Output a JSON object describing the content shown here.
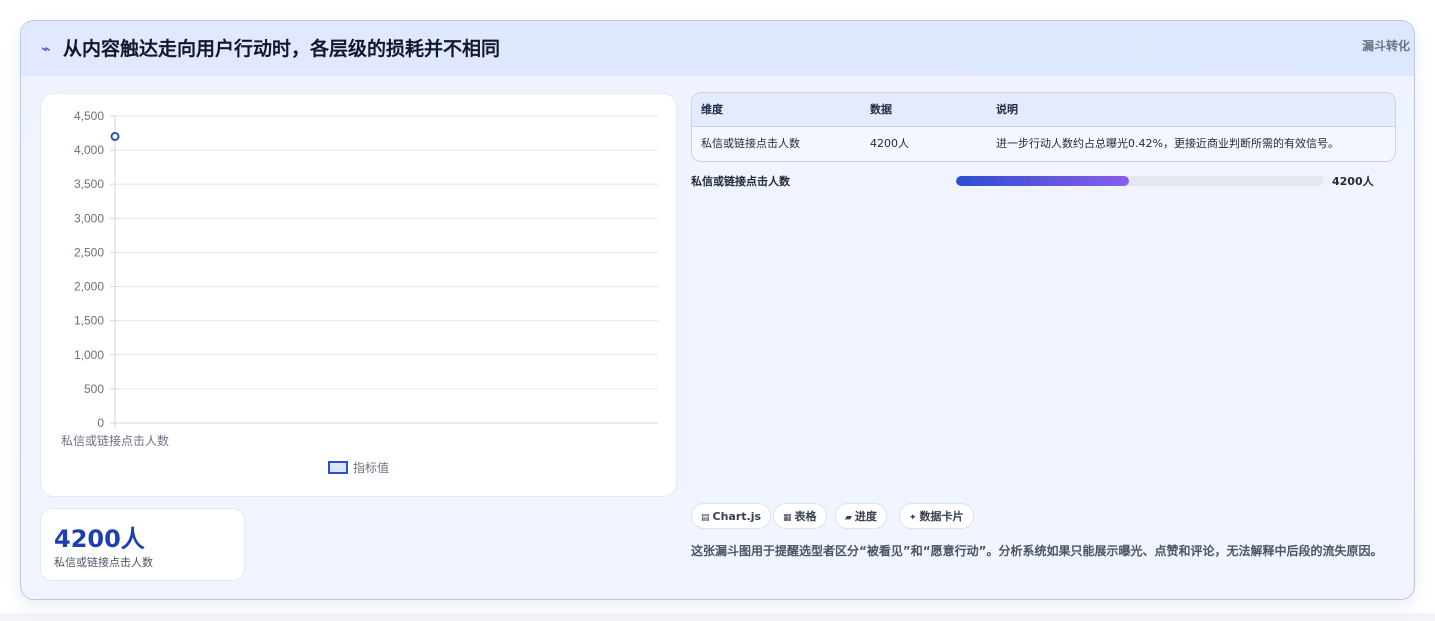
{
  "header": {
    "icon": "trend-line-icon",
    "icon_glyph": "⌁",
    "title": "从内容触达走向用户行动时，各层级的损耗并不相同",
    "category": "漏斗转化"
  },
  "colors": {
    "accent": "#2d4fcc",
    "accent_end": "#8a5cf0",
    "kpi": "#1e40af"
  },
  "chart_data": {
    "type": "line",
    "categories": [
      "私信或链接点击人数"
    ],
    "series": [
      {
        "name": "指标值",
        "values": [
          4200
        ]
      }
    ],
    "ylim": [
      0,
      4500
    ],
    "yticks": [
      "0",
      "500",
      "1,000",
      "1,500",
      "2,000",
      "2,500",
      "3,000",
      "3,500",
      "4,000",
      "4,500"
    ],
    "grid": true,
    "legend": "bottom"
  },
  "kpi": {
    "value": "4200人",
    "label": "私信或链接点击人数"
  },
  "table": {
    "headers": [
      "维度",
      "数据",
      "说明"
    ],
    "rows": [
      [
        "私信或链接点击人数",
        "4200人",
        "进一步行动人数约占总曝光0.42%，更接近商业判断所需的有效信号。"
      ]
    ]
  },
  "progress": {
    "label": "私信或链接点击人数",
    "value_text": "4200人",
    "fraction": 0.47
  },
  "chips": [
    {
      "icon": "chart-icon",
      "glyph": "▤",
      "label": "Chart.js"
    },
    {
      "icon": "table-icon",
      "glyph": "▦",
      "label": "表格"
    },
    {
      "icon": "progress-icon",
      "glyph": "▰",
      "label": "进度"
    },
    {
      "icon": "sparkle-icon",
      "glyph": "✦",
      "label": "数据卡片"
    }
  ],
  "description": "这张漏斗图用于提醒选型者区分“被看见”和“愿意行动”。分析系统如果只能展示曝光、点赞和评论，无法解释中后段的流失原因。"
}
